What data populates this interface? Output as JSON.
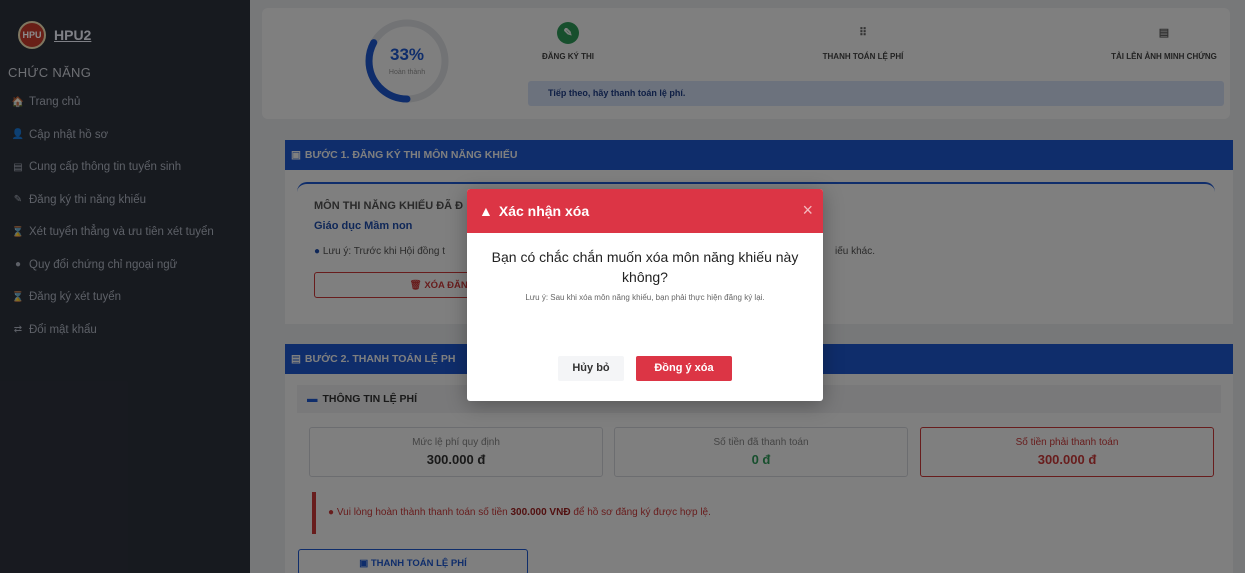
{
  "sidebar": {
    "brand": "HPU2",
    "logo_text": "HPU",
    "section": "CHỨC NĂNG",
    "items": [
      {
        "label": "Trang chủ",
        "icon": "🏠"
      },
      {
        "label": "Cập nhật hồ sơ",
        "icon": "👤"
      },
      {
        "label": "Cung cấp thông tin tuyển sinh",
        "icon": "▤"
      },
      {
        "label": "Đăng ký thi năng khiếu",
        "icon": "✎"
      },
      {
        "label": "Xét tuyển thẳng và ưu tiên xét tuyển",
        "icon": "⌛"
      },
      {
        "label": "Quy đổi chứng chỉ ngoại ngữ",
        "icon": "●"
      },
      {
        "label": "Đăng ký xét tuyển",
        "icon": "⌛"
      },
      {
        "label": "Đổi mật khẩu",
        "icon": "⇄"
      }
    ]
  },
  "progress": {
    "percent_label": "33%",
    "percent": 33,
    "subtitle": "Hoàn thành",
    "steps": [
      {
        "label": "ĐĂNG KÝ THI",
        "icon": "✎"
      },
      {
        "label": "THANH TOÁN LỆ PHÍ",
        "icon": "⠿"
      },
      {
        "label": "TẢI LÊN ẢNH MINH CHỨNG",
        "icon": "▤"
      }
    ],
    "next_message": "Tiếp theo, hãy thanh toán lệ phí."
  },
  "step1": {
    "header": "BƯỚC 1. ĐĂNG KÝ THI MÔN NĂNG KHIẾU",
    "subject_title": "MÔN THI NĂNG KHIẾU ĐÃ Đ",
    "subject_name": "Giáo dục Mầm non",
    "note_start": "Lưu ý: Trước khi Hội đồng t",
    "note_end": "iếu khác.",
    "delete_label": "XÓA ĐĂNG KÝ"
  },
  "step2": {
    "header": "BƯỚC 2. THANH TOÁN LỆ PH",
    "fee_header": "THÔNG TIN LỆ PHÍ",
    "fees": [
      {
        "label": "Mức lệ phí quy định",
        "value": "300.000 đ"
      },
      {
        "label": "Số tiền đã thanh toán",
        "value": "0 đ"
      },
      {
        "label": "Số tiền phải thanh toán",
        "value": "300.000 đ"
      }
    ],
    "warning_pre": "Vui lòng hoàn thành thanh toán số tiền",
    "warning_amount": "300.000 VNĐ",
    "warning_post": "để hồ sơ đăng ký được hợp lệ.",
    "pay_label": "THANH TOÁN LỆ PHÍ"
  },
  "modal": {
    "title": "Xác nhận xóa",
    "question": "Bạn có chắc chắn muốn xóa môn năng khiếu này không?",
    "note": "Lưu ý: Sau khi xóa môn năng khiếu, bạn phải thực hiện đăng ký lại.",
    "cancel_label": "Hủy bỏ",
    "confirm_label": "Đồng ý xóa",
    "close_symbol": "×"
  },
  "colors": {
    "primary": "#1f5bd6",
    "danger": "#dc3545",
    "success": "#2e9e5b",
    "sidebar": "#2b303a"
  }
}
